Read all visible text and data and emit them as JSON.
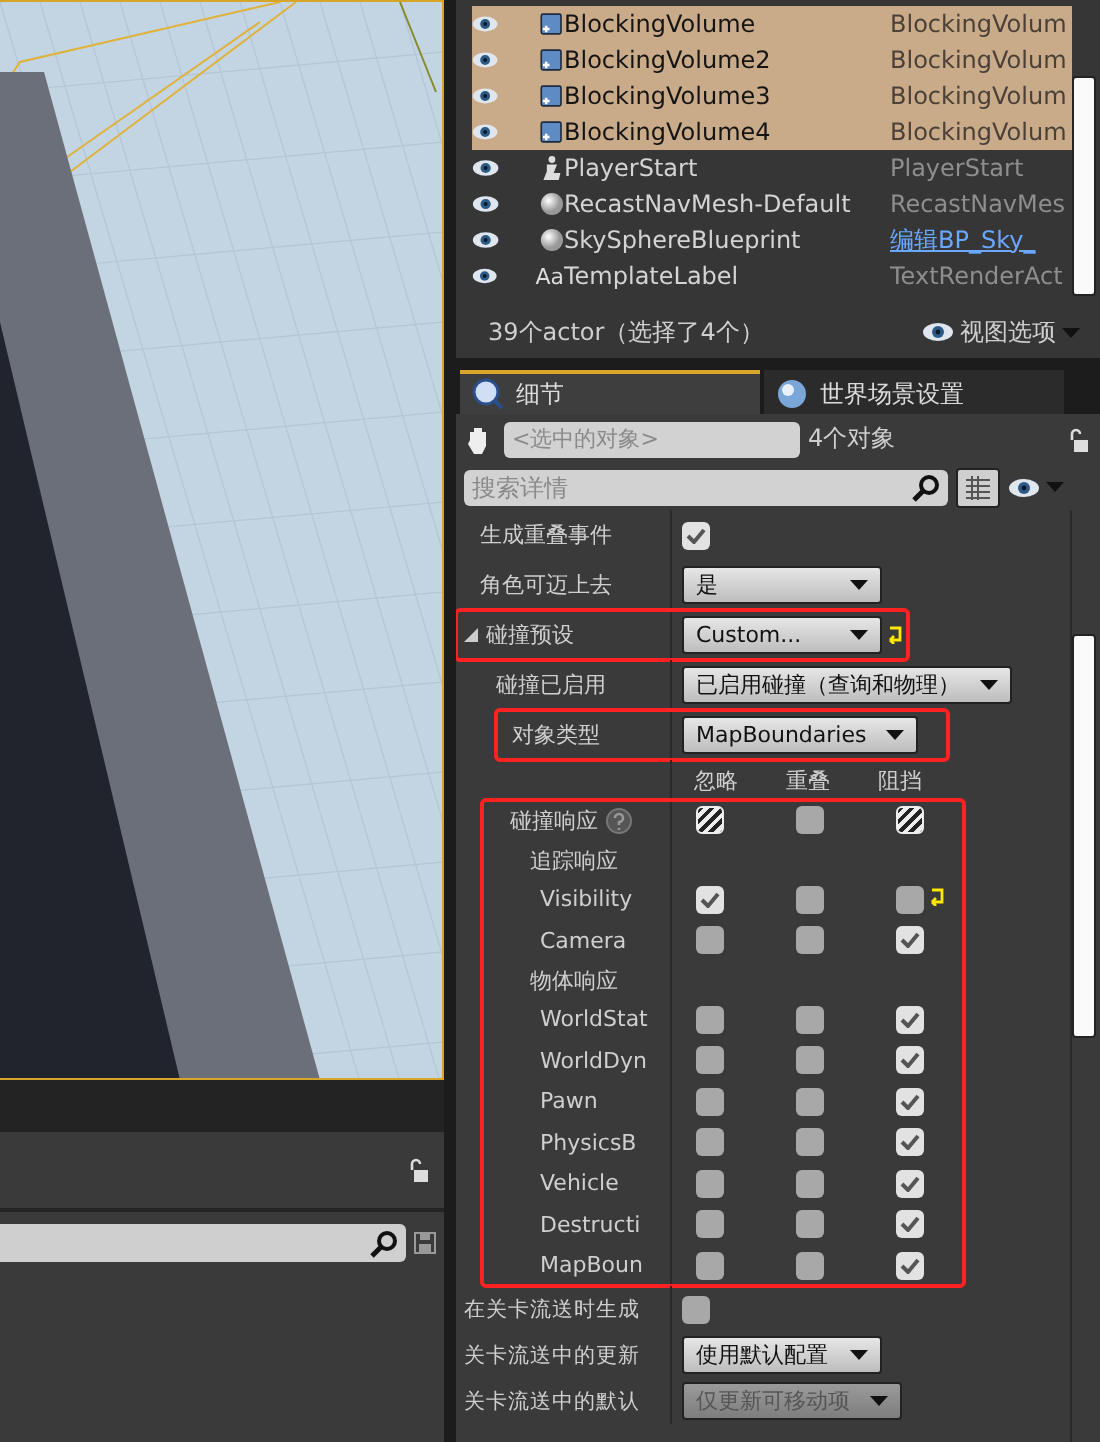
{
  "outliner": {
    "rows": [
      {
        "name": "BlockingVolume",
        "type": "BlockingVolum",
        "kind": "volume",
        "selected": true
      },
      {
        "name": "BlockingVolume2",
        "type": "BlockingVolum",
        "kind": "volume",
        "selected": true
      },
      {
        "name": "BlockingVolume3",
        "type": "BlockingVolum",
        "kind": "volume",
        "selected": true
      },
      {
        "name": "BlockingVolume4",
        "type": "BlockingVolum",
        "kind": "volume",
        "selected": true
      },
      {
        "name": "PlayerStart",
        "type": "PlayerStart",
        "kind": "player",
        "selected": false
      },
      {
        "name": "RecastNavMesh-Default",
        "type": "RecastNavMes",
        "kind": "sphere",
        "selected": false
      },
      {
        "name": "SkySphereBlueprint",
        "type": "编辑BP_Sky_",
        "type_is_link": true,
        "kind": "sphere",
        "selected": false
      },
      {
        "name": "TemplateLabel",
        "type": "TextRenderAct",
        "kind": "text",
        "icon_label": "Aa",
        "selected": false
      }
    ],
    "count": "39个actor（选择了4个）",
    "view_options": "视图选项"
  },
  "details": {
    "tabs": [
      {
        "label": "细节",
        "selected": true
      },
      {
        "label": "世界场景设置",
        "selected": false
      }
    ],
    "selection_placeholder": "<选中的对象>",
    "object_count": "4个对象",
    "search_placeholder": "搜索详情",
    "properties_top": [
      {
        "kind": "checkbox",
        "label": "生成重叠事件",
        "checked": true
      },
      {
        "kind": "dropdown",
        "label": "角色可迈上去",
        "value": "是"
      },
      {
        "kind": "dropdown",
        "label": "碰撞预设",
        "value": "Custom...",
        "expanded": true,
        "highlighted": true,
        "resettable": true
      },
      {
        "kind": "dropdown",
        "label": "碰撞已启用",
        "value": "已启用碰撞（查询和物理）",
        "indented": true
      },
      {
        "kind": "dropdown",
        "label": "对象类型",
        "value": "MapBoundaries",
        "indented": true,
        "highlighted": true
      }
    ],
    "columns": [
      "忽略",
      "重叠",
      "阻挡"
    ],
    "collision": {
      "highlighted": true,
      "rows": [
        {
          "kind": "header",
          "label": "碰撞响应",
          "cells": [
            {
              "mixed": true
            },
            {
              "mixed": false
            },
            {
              "mixed": true
            }
          ]
        },
        {
          "kind": "group",
          "label": "追踪响应"
        },
        {
          "kind": "channel",
          "label": "Visibility",
          "resettable": true,
          "cells": [
            {
              "checked": true
            },
            {
              "checked": false
            },
            {
              "checked": false
            }
          ]
        },
        {
          "kind": "channel",
          "label": "Camera",
          "cells": [
            {
              "checked": false
            },
            {
              "checked": false
            },
            {
              "checked": true
            }
          ]
        },
        {
          "kind": "group",
          "label": "物体响应"
        },
        {
          "kind": "channel",
          "label": "WorldStat",
          "cells": [
            {
              "checked": false
            },
            {
              "checked": false
            },
            {
              "checked": true
            }
          ]
        },
        {
          "kind": "channel",
          "label": "WorldDyn",
          "cells": [
            {
              "checked": false
            },
            {
              "checked": false
            },
            {
              "checked": true
            }
          ]
        },
        {
          "kind": "channel",
          "label": "Pawn",
          "cells": [
            {
              "checked": false
            },
            {
              "checked": false
            },
            {
              "checked": true
            }
          ]
        },
        {
          "kind": "channel",
          "label": "PhysicsB",
          "cells": [
            {
              "checked": false
            },
            {
              "checked": false
            },
            {
              "checked": true
            }
          ]
        },
        {
          "kind": "channel",
          "label": "Vehicle",
          "cells": [
            {
              "checked": false
            },
            {
              "checked": false
            },
            {
              "checked": true
            }
          ]
        },
        {
          "kind": "channel",
          "label": "Destructi",
          "cells": [
            {
              "checked": false
            },
            {
              "checked": false
            },
            {
              "checked": true
            }
          ]
        },
        {
          "kind": "channel",
          "label": "MapBoun",
          "cells": [
            {
              "checked": false
            },
            {
              "checked": false
            },
            {
              "checked": true
            }
          ]
        }
      ]
    },
    "properties_bottom": [
      {
        "kind": "checkbox",
        "label": "在关卡流送时生成",
        "checked": false
      },
      {
        "kind": "dropdown",
        "label": "关卡流送中的更新",
        "value": "使用默认配置"
      },
      {
        "kind": "dropdown",
        "label": "关卡流送中的默认",
        "value": "仅更新可移动项",
        "disabled": true
      }
    ]
  }
}
